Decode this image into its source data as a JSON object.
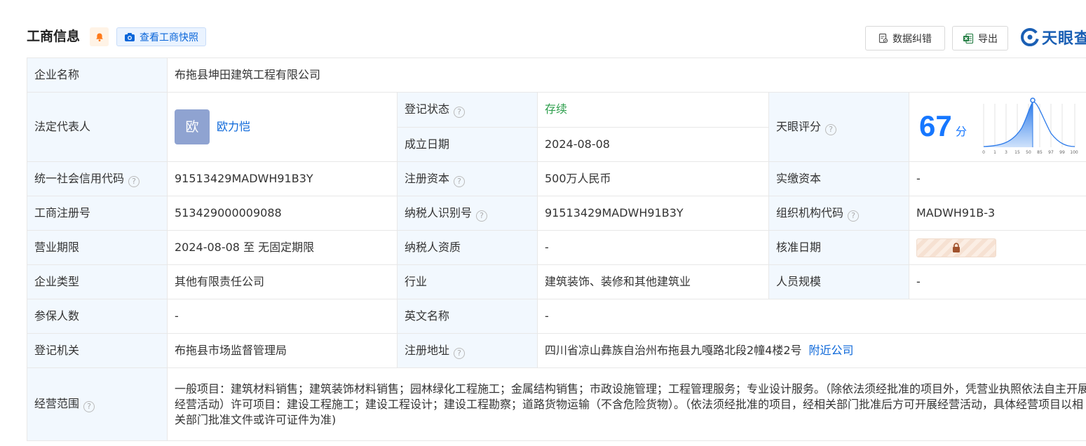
{
  "header": {
    "title": "工商信息",
    "snapshot_label": "查看工商快照",
    "correct_label": "数据纠错",
    "export_label": "导出",
    "logo_text": "天眼查"
  },
  "rows": {
    "company_name": {
      "label": "企业名称",
      "value": "布拖县坤田建筑工程有限公司"
    },
    "legal_rep": {
      "label": "法定代表人",
      "avatar_char": "欧",
      "name": "欧力恺"
    },
    "reg_status": {
      "label": "登记状态",
      "value": "存续"
    },
    "est_date": {
      "label": "成立日期",
      "value": "2024-08-08"
    },
    "tianyan_score": {
      "label": "天眼评分",
      "score": "67",
      "unit": "分",
      "ticks": [
        "0",
        "1",
        "3",
        "15",
        "50",
        "85",
        "97",
        "99",
        "100"
      ]
    },
    "credit_code": {
      "label": "统一社会信用代码",
      "value": "91513429MADWH91B3Y"
    },
    "reg_capital": {
      "label": "注册资本",
      "value": "500万人民币"
    },
    "paid_capital": {
      "label": "实缴资本",
      "value": "-"
    },
    "reg_number": {
      "label": "工商注册号",
      "value": "513429000009088"
    },
    "taxpayer_id": {
      "label": "纳税人识别号",
      "value": "91513429MADWH91B3Y"
    },
    "org_code": {
      "label": "组织机构代码",
      "value": "MADWH91B-3"
    },
    "biz_term": {
      "label": "营业期限",
      "value": "2024-08-08 至 无固定期限"
    },
    "taxpayer_qual": {
      "label": "纳税人资质",
      "value": "-"
    },
    "approve_date": {
      "label": "核准日期"
    },
    "company_type": {
      "label": "企业类型",
      "value": "其他有限责任公司"
    },
    "industry": {
      "label": "行业",
      "value": "建筑装饰、装修和其他建筑业"
    },
    "staff_size": {
      "label": "人员规模",
      "value": "-"
    },
    "insured": {
      "label": "参保人数",
      "value": "-"
    },
    "english_name": {
      "label": "英文名称",
      "value": "-"
    },
    "reg_authority": {
      "label": "登记机关",
      "value": "布拖县市场监督管理局"
    },
    "reg_address": {
      "label": "注册地址",
      "value": "四川省凉山彝族自治州布拖县九嘎路北段2幢4楼2号",
      "nearby_label": "附近公司"
    },
    "biz_scope": {
      "label": "经营范围",
      "value": "一般项目：建筑材料销售；建筑装饰材料销售；园林绿化工程施工；金属结构销售；市政设施管理；工程管理服务；专业设计服务。（除依法须经批准的项目外，凭营业执照依法自主开展经营活动）许可项目：建设工程施工；建设工程设计；建设工程勘察；道路货物运输（不含危险货物）。（依法须经批准的项目，经相关部门批准后方可开展经营活动，具体经营项目以相关部门批准文件或许可证件为准)"
    }
  },
  "colors": {
    "accent": "#1677ff",
    "status_live": "#2c9e4b",
    "label_bg": "#f2f8fe"
  }
}
